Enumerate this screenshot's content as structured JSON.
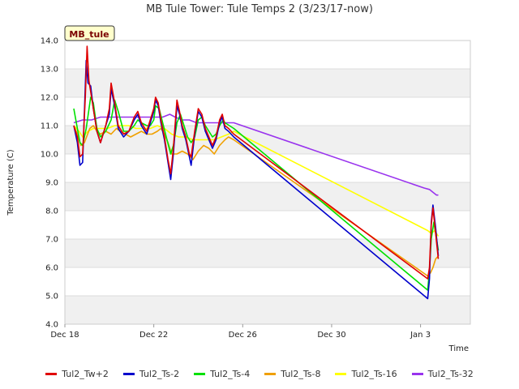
{
  "chart_data": {
    "type": "line",
    "title": "MB Tule Tower: Tule Temps 2 (3/23/17-now)",
    "xlabel": "Time",
    "ylabel": "Temperature (C)",
    "ylim": [
      4.0,
      14.0
    ],
    "yticks": [
      "4.0",
      "5.0",
      "6.0",
      "7.0",
      "8.0",
      "9.0",
      "10.0",
      "11.0",
      "12.0",
      "13.0",
      "14.0"
    ],
    "xlim": [
      0,
      22.8
    ],
    "xticks": [
      {
        "x": 0,
        "label": "Dec 18"
      },
      {
        "x": 5,
        "label": "Dec 22"
      },
      {
        "x": 10,
        "label": "Dec 26"
      },
      {
        "x": 15,
        "label": "Dec 30"
      },
      {
        "x": 20,
        "label": "Jan 3"
      }
    ],
    "annotation": "MB_tule",
    "grid": true,
    "legend_position": "bottom",
    "series": [
      {
        "name": "Tul2_Tw+2",
        "color": "#e00000",
        "points": [
          [
            0.5,
            11.0
          ],
          [
            0.7,
            10.6
          ],
          [
            0.85,
            9.9
          ],
          [
            1.0,
            10.0
          ],
          [
            1.15,
            12.0
          ],
          [
            1.25,
            13.8
          ],
          [
            1.35,
            12.6
          ],
          [
            1.5,
            12.0
          ],
          [
            1.8,
            10.8
          ],
          [
            2.0,
            10.4
          ],
          [
            2.3,
            11.0
          ],
          [
            2.5,
            11.6
          ],
          [
            2.6,
            12.5
          ],
          [
            2.8,
            11.8
          ],
          [
            3.0,
            11.0
          ],
          [
            3.3,
            10.7
          ],
          [
            3.6,
            10.8
          ],
          [
            3.9,
            11.3
          ],
          [
            4.1,
            11.5
          ],
          [
            4.3,
            11.1
          ],
          [
            4.6,
            10.8
          ],
          [
            4.8,
            11.2
          ],
          [
            5.0,
            11.6
          ],
          [
            5.1,
            12.0
          ],
          [
            5.25,
            11.8
          ],
          [
            5.4,
            11.2
          ],
          [
            5.6,
            10.6
          ],
          [
            5.8,
            9.8
          ],
          [
            5.95,
            9.3
          ],
          [
            6.1,
            10.2
          ],
          [
            6.3,
            11.9
          ],
          [
            6.45,
            11.5
          ],
          [
            6.6,
            11.0
          ],
          [
            6.8,
            10.6
          ],
          [
            7.0,
            10.0
          ],
          [
            7.1,
            9.9
          ],
          [
            7.3,
            10.8
          ],
          [
            7.5,
            11.6
          ],
          [
            7.7,
            11.4
          ],
          [
            7.9,
            10.9
          ],
          [
            8.1,
            10.6
          ],
          [
            8.3,
            10.3
          ],
          [
            8.5,
            10.6
          ],
          [
            8.7,
            11.2
          ],
          [
            8.85,
            11.4
          ],
          [
            9.0,
            11.0
          ],
          [
            9.2,
            10.9
          ],
          [
            9.5,
            10.7
          ],
          [
            20.4,
            5.6
          ],
          [
            20.5,
            6.0
          ],
          [
            20.6,
            7.5
          ],
          [
            20.7,
            8.1
          ],
          [
            20.85,
            7.2
          ],
          [
            21.0,
            6.3
          ]
        ]
      },
      {
        "name": "Tul2_Ts-2",
        "color": "#0000cc",
        "points": [
          [
            0.5,
            11.0
          ],
          [
            0.7,
            10.4
          ],
          [
            0.85,
            9.6
          ],
          [
            1.0,
            9.7
          ],
          [
            1.1,
            11.5
          ],
          [
            1.2,
            13.3
          ],
          [
            1.3,
            12.5
          ],
          [
            1.45,
            12.4
          ],
          [
            1.6,
            11.6
          ],
          [
            1.8,
            10.8
          ],
          [
            2.0,
            10.4
          ],
          [
            2.3,
            11.0
          ],
          [
            2.5,
            11.4
          ],
          [
            2.6,
            12.3
          ],
          [
            2.8,
            11.7
          ],
          [
            3.0,
            10.9
          ],
          [
            3.3,
            10.6
          ],
          [
            3.6,
            10.8
          ],
          [
            3.9,
            11.2
          ],
          [
            4.1,
            11.4
          ],
          [
            4.3,
            11.0
          ],
          [
            4.6,
            10.7
          ],
          [
            4.8,
            11.1
          ],
          [
            5.0,
            11.5
          ],
          [
            5.1,
            11.9
          ],
          [
            5.25,
            11.7
          ],
          [
            5.4,
            11.1
          ],
          [
            5.6,
            10.5
          ],
          [
            5.8,
            9.7
          ],
          [
            5.95,
            9.1
          ],
          [
            6.1,
            10.0
          ],
          [
            6.3,
            11.7
          ],
          [
            6.45,
            11.4
          ],
          [
            6.6,
            10.9
          ],
          [
            6.8,
            10.5
          ],
          [
            7.0,
            9.9
          ],
          [
            7.1,
            9.6
          ],
          [
            7.3,
            10.7
          ],
          [
            7.5,
            11.5
          ],
          [
            7.7,
            11.3
          ],
          [
            7.9,
            10.8
          ],
          [
            8.1,
            10.5
          ],
          [
            8.3,
            10.2
          ],
          [
            8.5,
            10.5
          ],
          [
            8.7,
            11.1
          ],
          [
            8.85,
            11.3
          ],
          [
            9.0,
            10.9
          ],
          [
            9.2,
            10.8
          ],
          [
            9.5,
            10.6
          ],
          [
            20.4,
            4.9
          ],
          [
            20.5,
            5.6
          ],
          [
            20.6,
            7.6
          ],
          [
            20.7,
            8.2
          ],
          [
            20.85,
            7.4
          ],
          [
            21.0,
            6.4
          ]
        ]
      },
      {
        "name": "Tul2_Ts-4",
        "color": "#00e000",
        "points": [
          [
            0.5,
            11.6
          ],
          [
            0.7,
            10.9
          ],
          [
            0.85,
            10.4
          ],
          [
            1.0,
            10.3
          ],
          [
            1.2,
            10.9
          ],
          [
            1.45,
            12.0
          ],
          [
            1.6,
            11.8
          ],
          [
            1.8,
            10.9
          ],
          [
            2.0,
            10.6
          ],
          [
            2.3,
            10.8
          ],
          [
            2.6,
            11.2
          ],
          [
            2.8,
            11.9
          ],
          [
            3.0,
            11.5
          ],
          [
            3.3,
            10.8
          ],
          [
            3.6,
            10.8
          ],
          [
            3.9,
            11.0
          ],
          [
            4.1,
            11.2
          ],
          [
            4.3,
            11.1
          ],
          [
            4.6,
            11.0
          ],
          [
            4.8,
            11.0
          ],
          [
            5.0,
            11.2
          ],
          [
            5.1,
            11.7
          ],
          [
            5.3,
            11.6
          ],
          [
            5.5,
            11.1
          ],
          [
            5.7,
            10.6
          ],
          [
            5.95,
            10.0
          ],
          [
            6.1,
            10.3
          ],
          [
            6.3,
            11.1
          ],
          [
            6.5,
            11.4
          ],
          [
            6.7,
            11.0
          ],
          [
            6.9,
            10.6
          ],
          [
            7.1,
            10.4
          ],
          [
            7.3,
            10.6
          ],
          [
            7.5,
            11.2
          ],
          [
            7.7,
            11.3
          ],
          [
            7.9,
            11.0
          ],
          [
            8.1,
            10.8
          ],
          [
            8.3,
            10.6
          ],
          [
            8.5,
            10.7
          ],
          [
            8.7,
            11.0
          ],
          [
            8.9,
            11.2
          ],
          [
            9.0,
            11.1
          ],
          [
            9.5,
            10.9
          ],
          [
            20.4,
            5.2
          ],
          [
            20.5,
            5.9
          ],
          [
            20.6,
            7.0
          ],
          [
            20.75,
            7.6
          ],
          [
            20.9,
            7.0
          ],
          [
            21.0,
            6.6
          ]
        ]
      },
      {
        "name": "Tul2_Ts-8",
        "color": "#f0a000",
        "points": [
          [
            0.5,
            11.0
          ],
          [
            0.7,
            10.7
          ],
          [
            0.9,
            10.3
          ],
          [
            1.1,
            10.4
          ],
          [
            1.4,
            10.9
          ],
          [
            1.6,
            11.0
          ],
          [
            1.8,
            10.8
          ],
          [
            2.0,
            10.7
          ],
          [
            2.3,
            10.8
          ],
          [
            2.6,
            10.7
          ],
          [
            2.9,
            10.9
          ],
          [
            3.1,
            10.8
          ],
          [
            3.4,
            10.7
          ],
          [
            3.7,
            10.6
          ],
          [
            4.0,
            10.7
          ],
          [
            4.3,
            10.8
          ],
          [
            4.6,
            10.7
          ],
          [
            4.9,
            10.7
          ],
          [
            5.2,
            10.8
          ],
          [
            5.4,
            10.9
          ],
          [
            5.6,
            10.7
          ],
          [
            5.8,
            10.4
          ],
          [
            6.0,
            10.0
          ],
          [
            6.3,
            10.0
          ],
          [
            6.6,
            10.1
          ],
          [
            6.9,
            10.0
          ],
          [
            7.2,
            9.8
          ],
          [
            7.5,
            10.1
          ],
          [
            7.8,
            10.3
          ],
          [
            8.1,
            10.2
          ],
          [
            8.4,
            10.0
          ],
          [
            8.7,
            10.3
          ],
          [
            9.0,
            10.5
          ],
          [
            9.2,
            10.6
          ],
          [
            9.5,
            10.5
          ],
          [
            20.4,
            5.7
          ],
          [
            20.55,
            5.8
          ],
          [
            20.7,
            6.0
          ],
          [
            20.85,
            6.3
          ],
          [
            21.0,
            6.4
          ]
        ]
      },
      {
        "name": "Tul2_Ts-16",
        "color": "#ffff00",
        "points": [
          [
            0.5,
            11.0
          ],
          [
            0.8,
            10.8
          ],
          [
            1.0,
            10.6
          ],
          [
            1.3,
            10.8
          ],
          [
            1.6,
            10.9
          ],
          [
            2.0,
            10.9
          ],
          [
            2.4,
            10.9
          ],
          [
            2.8,
            11.0
          ],
          [
            3.2,
            11.0
          ],
          [
            3.6,
            11.0
          ],
          [
            4.0,
            10.9
          ],
          [
            4.4,
            10.9
          ],
          [
            4.8,
            10.9
          ],
          [
            5.2,
            11.0
          ],
          [
            5.6,
            10.9
          ],
          [
            6.0,
            10.7
          ],
          [
            6.4,
            10.6
          ],
          [
            6.8,
            10.6
          ],
          [
            7.2,
            10.5
          ],
          [
            7.6,
            10.5
          ],
          [
            8.0,
            10.5
          ],
          [
            8.4,
            10.5
          ],
          [
            8.8,
            10.6
          ],
          [
            9.2,
            10.7
          ],
          [
            9.5,
            10.8
          ],
          [
            20.4,
            7.3
          ],
          [
            20.6,
            7.2
          ],
          [
            20.8,
            7.3
          ],
          [
            21.0,
            7.1
          ]
        ]
      },
      {
        "name": "Tul2_Ts-32",
        "color": "#9933ee",
        "points": [
          [
            0.5,
            11.1
          ],
          [
            1.0,
            11.2
          ],
          [
            1.5,
            11.2
          ],
          [
            2.0,
            11.3
          ],
          [
            2.5,
            11.3
          ],
          [
            3.0,
            11.3
          ],
          [
            3.5,
            11.3
          ],
          [
            4.0,
            11.3
          ],
          [
            4.5,
            11.3
          ],
          [
            5.0,
            11.3
          ],
          [
            5.5,
            11.3
          ],
          [
            5.9,
            11.4
          ],
          [
            6.2,
            11.3
          ],
          [
            6.6,
            11.2
          ],
          [
            7.0,
            11.2
          ],
          [
            7.4,
            11.1
          ],
          [
            7.8,
            11.1
          ],
          [
            8.2,
            11.1
          ],
          [
            8.6,
            11.1
          ],
          [
            9.0,
            11.1
          ],
          [
            9.5,
            11.1
          ],
          [
            20.2,
            8.8
          ],
          [
            20.5,
            8.75
          ],
          [
            20.7,
            8.65
          ],
          [
            20.9,
            8.55
          ],
          [
            21.0,
            8.55
          ]
        ]
      }
    ]
  }
}
